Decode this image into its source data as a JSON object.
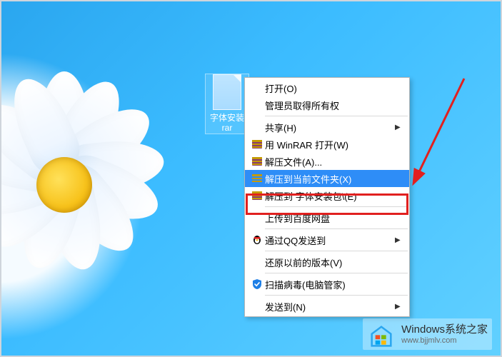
{
  "file": {
    "label_line1": "字体安装",
    "label_line2": "rar"
  },
  "menu": {
    "items": [
      {
        "type": "item",
        "label": "打开(O)",
        "icon": null,
        "submenu": false
      },
      {
        "type": "item",
        "label": "管理员取得所有权",
        "icon": null,
        "submenu": false
      },
      {
        "type": "sep"
      },
      {
        "type": "item",
        "label": "共享(H)",
        "icon": null,
        "submenu": true
      },
      {
        "type": "item",
        "label": "用 WinRAR 打开(W)",
        "icon": "rar",
        "submenu": false
      },
      {
        "type": "item",
        "label": "解压文件(A)...",
        "icon": "rar",
        "submenu": false
      },
      {
        "type": "item",
        "label": "解压到当前文件夹(X)",
        "icon": "rar-blue",
        "submenu": false,
        "hovered": true
      },
      {
        "type": "item",
        "label": "解压到 字体安装包\\(E)",
        "icon": "rar",
        "submenu": false
      },
      {
        "type": "sep"
      },
      {
        "type": "item",
        "label": "上传到百度网盘",
        "icon": null,
        "submenu": false
      },
      {
        "type": "sep"
      },
      {
        "type": "item",
        "label": "通过QQ发送到",
        "icon": "qq",
        "submenu": true
      },
      {
        "type": "sep"
      },
      {
        "type": "item",
        "label": "还原以前的版本(V)",
        "icon": null,
        "submenu": false
      },
      {
        "type": "sep"
      },
      {
        "type": "item",
        "label": "扫描病毒(电脑管家)",
        "icon": "shield",
        "submenu": false
      },
      {
        "type": "sep"
      },
      {
        "type": "item",
        "label": "发送到(N)",
        "icon": null,
        "submenu": true
      }
    ]
  },
  "annotation": {
    "highlight_color": "#e1201f",
    "arrow_color": "#e1201f"
  },
  "watermark": {
    "title": "Windows系统之家",
    "url": "www.bjjmlv.com"
  }
}
